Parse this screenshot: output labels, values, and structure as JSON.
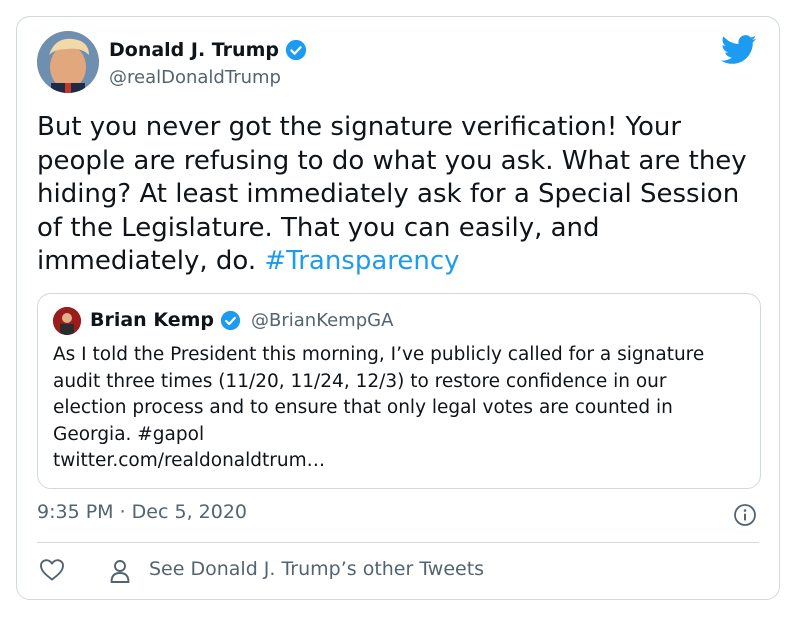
{
  "author": {
    "name": "Donald J. Trump",
    "handle": "@realDonaldTrump",
    "avatar_icon": "avatar-photo"
  },
  "tweet": {
    "text": "But you never got the signature verification! Your people are refusing to do what you ask. What are they hiding? At least immediately ask for a Special Session of the Legislature. That you can easily, and immediately, do.",
    "hashtag": "#Transparency"
  },
  "quoted_tweet": {
    "name": "Brian Kemp",
    "handle": "@BrianKempGA",
    "text": "As I told the President this morning, I’ve publicly called for a signature audit three times (11/20, 11/24, 12/3) to restore confidence in our election process and to ensure that only legal votes are counted in Georgia. #gapol",
    "link": "twitter.com/realdonaldtrum…"
  },
  "meta": {
    "timestamp": "9:35 PM · Dec 5, 2020",
    "see_other_label": "See Donald J. Trump’s other Tweets"
  },
  "colors": {
    "accent": "#1d9bf0",
    "secondary_text": "#536471",
    "border": "#cfd9de"
  }
}
